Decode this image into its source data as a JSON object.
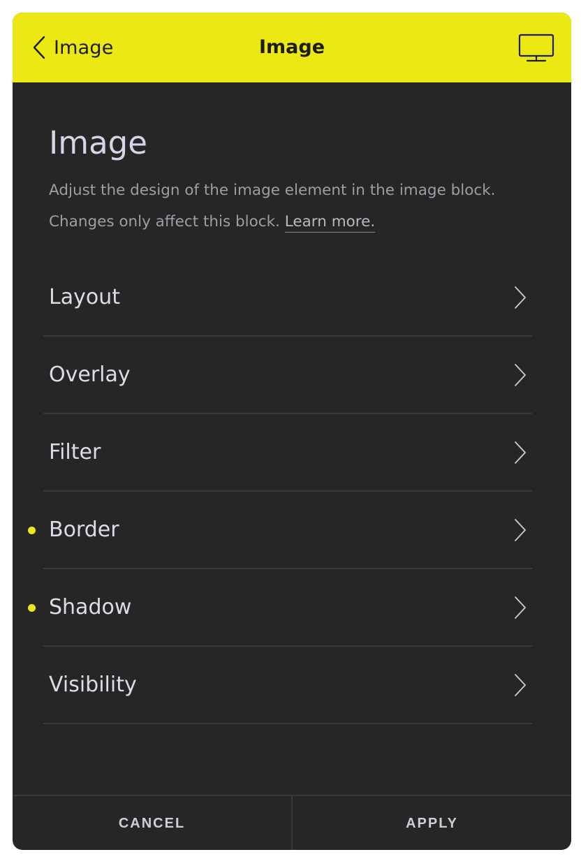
{
  "header": {
    "back_label": "Image",
    "title": "Image",
    "back_icon": "chevron-left-icon",
    "device_icon": "desktop-icon",
    "background_color": "#ece814"
  },
  "content": {
    "title": "Image",
    "description": "Adjust the design of the image element in the image block. Changes only affect this block.",
    "learn_more": "Learn more."
  },
  "items": [
    {
      "label": "Layout",
      "modified": false
    },
    {
      "label": "Overlay",
      "modified": false
    },
    {
      "label": "Filter",
      "modified": false
    },
    {
      "label": "Border",
      "modified": true
    },
    {
      "label": "Shadow",
      "modified": true
    },
    {
      "label": "Visibility",
      "modified": false
    }
  ],
  "footer": {
    "cancel_label": "CANCEL",
    "apply_label": "APPLY"
  },
  "colors": {
    "panel_background": "#262626",
    "accent": "#ece814",
    "modified_dot": "#ece814"
  }
}
